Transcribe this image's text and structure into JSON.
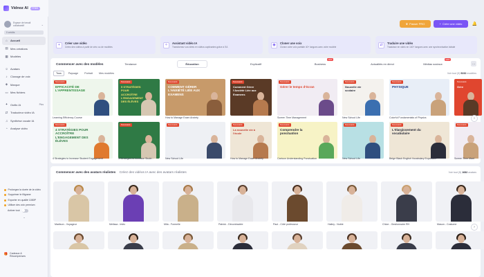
{
  "brand": {
    "name": "Vidnoz AI",
    "badge": "FREE"
  },
  "workspace": {
    "line1": "Espace de travail",
    "line2": "collaboratif",
    "credits": "0 crédits"
  },
  "nav": [
    {
      "label": "Accueil",
      "icon": "home-icon",
      "active": true
    },
    {
      "label": "Mes créations",
      "icon": "folder-icon"
    },
    {
      "label": "Modèles",
      "icon": "template-icon"
    },
    {
      "label": "Avatars",
      "icon": "avatar-icon"
    },
    {
      "label": "Clonage de voix",
      "icon": "voice-icon"
    },
    {
      "label": "Marque",
      "icon": "brand-icon"
    },
    {
      "label": "Mes fichiers",
      "icon": "file-icon"
    },
    {
      "label": "Outils IA",
      "icon": "tools-icon",
      "badge": "Plus"
    },
    {
      "label": "Traducteur vidéo IA",
      "icon": "translate-icon"
    },
    {
      "label": "Synthèse vocale IA",
      "icon": "tts-icon"
    },
    {
      "label": "Analyse vidéo",
      "icon": "analysis-icon"
    }
  ],
  "upsell": {
    "items": [
      "Prolongez la durée de la vidéo",
      "Supprimer le filigrane",
      "Exporter en qualité 1080P",
      "Utiliser des voix premium"
    ],
    "toggle_label": "Activer tout",
    "gift_line1": "Cadeaux &",
    "gift_line2": "Récompenses"
  },
  "topbar": {
    "pro_label": "Passer PRO",
    "create_label": "Créer une vidéo"
  },
  "quick_actions": [
    {
      "title": "Créer une vidéo",
      "sub": "Créez des vidéos à partir de zéro ou de modèles",
      "icon": "plus-icon"
    },
    {
      "title": "Assistant vidéo IA",
      "sub": "Transformez vos idées en vidéos captivantes grâce à l'IA",
      "icon": "ai-icon"
    },
    {
      "title": "Cloner une voix",
      "sub": "Clonez votre voix parfaite 40+ langues avec votre modèle",
      "icon": "clone-voice-icon"
    },
    {
      "title": "Traduire une vidéo",
      "sub": "Traduisez en vidéo en 140+ langues avec une synchronisation labiale",
      "icon": "translate-icon"
    }
  ],
  "templates": {
    "heading": "Commencer avec des modèles",
    "tabs": [
      "Tendance",
      "Éducation",
      "Explicatif",
      "Business",
      "Actualités en direct",
      "Médias sociaux"
    ],
    "chips": [
      "Tous",
      "Paysage",
      "Portrait",
      "Mes modèles"
    ],
    "see_all_prefix": "Voir tout (5)",
    "see_all_count": "5232",
    "see_all_suffix": "modèles",
    "row1": [
      {
        "caption": "Learning Efficiency Course",
        "text": "EFFICACITÉ DE L'APPRENTISSAGE",
        "bg": "#eef6ec",
        "fg": "#2a8a3a",
        "person": "#2f4f7f"
      },
      {
        "caption": "",
        "text": "5 STRATÉGIES POUR ACCROÎTRE L'ENGAGEMENT DES ÉLÈVES",
        "bg": "#2f7a45",
        "fg": "#f4e36a",
        "person": "#d6c7b2"
      },
      {
        "caption": "How to Manage Exam Anxiety",
        "text": "COMMENT GÉRER L'ANXIÉTÉ LIÉE AUX EXAMENS",
        "bg": "#c79a6a",
        "fg": "#ffffff",
        "person": "#8a5e3c"
      },
      {
        "caption": "",
        "text": "Comment Gérer l'Anxiété Liée aux Examens",
        "bg": "#5a3a26",
        "fg": "#ffffff",
        "person": "#b67a4e"
      },
      {
        "caption": "Screen Time Management",
        "text": "Gérer le temps d'écran",
        "bg": "#f1ecf3",
        "fg": "#e0462f",
        "person": "#6b4b8a"
      },
      {
        "caption": "New School Life",
        "text": "Nouvelle vie scolaire",
        "bg": "#f4f2ee",
        "fg": "#2b2d3a",
        "person": "#3b6fb0"
      },
      {
        "caption": "Colorful Fundamentals of Physics",
        "text": "PHYSIQUE",
        "bg": "#e8eef7",
        "fg": "#1f3f8a",
        "person": "#c9a27a"
      },
      {
        "caption": "",
        "text": "Gére",
        "bg": "#e0462f",
        "fg": "#ffffff",
        "person": "#5a3a26"
      }
    ],
    "row2": [
      {
        "caption": "4 Strategies to Increase Student Engagement",
        "text": "4 STRATÉGIES POUR ACCROÎTRE L'ENGAGEMENT DES ÉLÈVES",
        "bg": "#eef6ec",
        "fg": "#2f7a45",
        "person": "#e07a2f"
      },
      {
        "caption": "4 Strategies to Increase Stude...",
        "text": "",
        "bg": "#2f7a45",
        "fg": "#ffffff",
        "person": "#d6c7b2"
      },
      {
        "caption": "New School Life",
        "text": "",
        "bg": "#eef0f4",
        "fg": "#2b2d3a",
        "person": "#3a4a6a"
      },
      {
        "caption": "How to Manage Exam Anxiety",
        "text": "La nouvelle vie à l'école",
        "bg": "#efe6d6",
        "fg": "#c0392b",
        "person": "#b67a4e"
      },
      {
        "caption": "Cartoon Understanding Punctuation",
        "text": "Comprendre la ponctuation",
        "bg": "#f7f3c6",
        "fg": "#2b2d3a",
        "person": "#59a85a"
      },
      {
        "caption": "New School Life",
        "text": "",
        "bg": "#b8e0e4",
        "fg": "#2b2d3a",
        "person": "#2f4f7f"
      },
      {
        "caption": "Beige Black English Vocabulary Expansion",
        "text": "L'élargissement du vocabulaire",
        "bg": "#efe6d6",
        "fg": "#2b2d3a",
        "person": "#2b2d3a"
      },
      {
        "caption": "Screen Time Mant",
        "text": "",
        "bg": "#f1ecf3",
        "fg": "#2b2d3a",
        "person": "#c9a27a"
      }
    ]
  },
  "avatars": {
    "heading": "Commencer avec des avatars réalistes",
    "sub": "Créez des vidéos IA avec des avatars réalistes",
    "see_all_prefix": "Voir tout (5)",
    "see_all_count": "1682",
    "see_all_suffix": "avatars",
    "row1": [
      {
        "name": "Madison - Voyageur",
        "hair": "#b98a4a",
        "body": "#d9c6a6"
      },
      {
        "name": "Melissa - Intéc",
        "hair": "#3a2a1e",
        "body": "#6b3fb4"
      },
      {
        "name": "Mila - Formelle",
        "hair": "#a87a4a",
        "body": "#c9b08a"
      },
      {
        "name": "Patrick - Décontractée",
        "hair": "#5a4030",
        "body": "#e8e8ec"
      },
      {
        "name": "Paul - Côté professeur",
        "hair": "#4a3020",
        "body": "#6b4a2e"
      },
      {
        "name": "Hailey - Noble",
        "hair": "#7a5a3a",
        "body": "#f0ece8"
      },
      {
        "name": "Chloe - Gestionnaire RH",
        "hair": "#c9a070",
        "body": "#3a3d4a"
      },
      {
        "name": "Mason - Costume",
        "hair": "#3a2a1e",
        "body": "#2b2d3a"
      }
    ],
    "row2": [
      {
        "hair": "#6a4a30",
        "body": "#d9c6a6"
      },
      {
        "hair": "#2a1e16",
        "body": "#3a3d4a"
      },
      {
        "hair": "#7a5a3a",
        "body": "#c9b08a"
      },
      {
        "hair": "#3a2a1e",
        "body": "#2b2d3a"
      },
      {
        "hair": "#5a4030",
        "body": "#e0d2c0"
      },
      {
        "hair": "#4a3020",
        "body": "#6b4a2e"
      },
      {
        "hair": "#3a2a1e",
        "body": "#3a3d4a"
      },
      {
        "hair": "#2a1e16",
        "body": "#2b2d3a"
      }
    ]
  }
}
